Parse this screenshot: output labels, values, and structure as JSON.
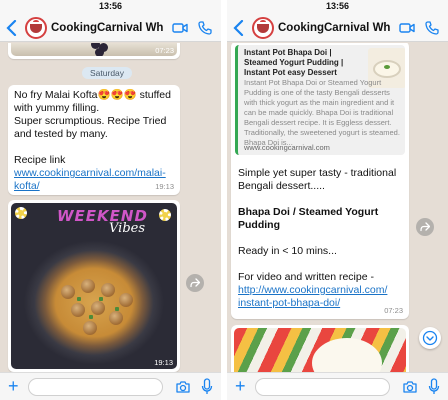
{
  "status_time": "13:56",
  "chat_title": "CookingCarnival What...",
  "icons": {
    "back": "chevron-left-icon",
    "video": "video-camera-icon",
    "call": "phone-icon",
    "attach": "plus-icon",
    "camera": "camera-icon",
    "mic": "microphone-icon",
    "forward": "share-forward-icon",
    "scroll_down": "chevron-down-circle-icon"
  },
  "colors": {
    "accent": "#1a84f0",
    "chat_background": "#e5ddd5",
    "link": "#1a73c7",
    "weekend_text": "#d056c8"
  },
  "left": {
    "top_image_time": "07:23",
    "date_chip": "Saturday",
    "msg1": {
      "line1": "No fry Malai Kofta😍😍😍 stuffed",
      "line2": "with yummy filling.",
      "line3": "Super scrumptious. Recipe Tried",
      "line4": "and tested by many.",
      "line5": "Recipe link",
      "link_part1": "www.cookingcarnival.com/malai-",
      "link_part2": "kofta/",
      "time": "19:13"
    },
    "img2": {
      "overlay_word1": "WEEKEND",
      "overlay_word2": "Vibes",
      "time": "19:13"
    }
  },
  "right": {
    "preview": {
      "title": "Instant Pot Bhapa Doi | Steamed Yogurt Pudding | Instant Pot easy Dessert",
      "description": "Instant Pot Bhapa Doi or Steamed Yogurt Pudding is one of the tasty Bengali desserts with thick yogurt as the main ingredient and it can be made quickly. Bhapa Doi is traditional Bengali dessert recipe. It is Eggless dessert. Traditionally, the sweetened yogurt is steamed. Bhapa Doi is...",
      "url": "www.cookingcarnival.com"
    },
    "msg": {
      "line1": "Simple yet super tasty - traditional",
      "line2": "Bengali dessert.....",
      "heading1": "Bhapa Doi / Steamed Yogurt",
      "heading2": "Pudding",
      "ready": "Ready in < 10 mins...",
      "cta": "For video and written recipe -",
      "link1": "http://www.cookingcarnival.com/",
      "link2": "instant-pot-bhapa-doi/",
      "time": "07:23"
    }
  }
}
